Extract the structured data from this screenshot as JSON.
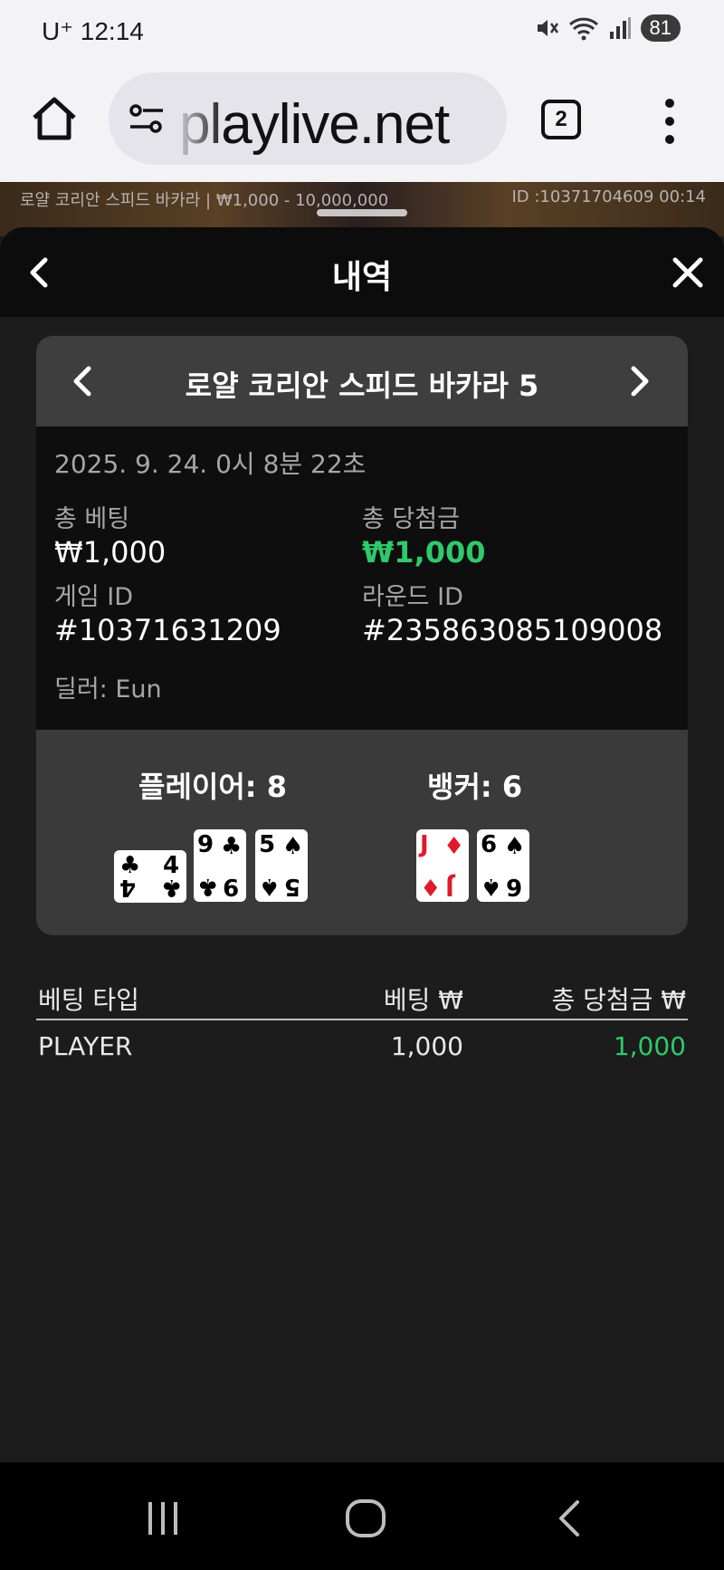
{
  "status": {
    "carrier": "U⁺ 12:14",
    "battery": "81",
    "icons": [
      "mute-icon",
      "wifi-icon",
      "signal-icon"
    ]
  },
  "browser": {
    "url": "playlive.net",
    "tab_count": "2"
  },
  "game_strip": {
    "left_text": "로얄 코리안 스피드 바카라 | ₩1,000 - 10,000,000",
    "right_text": "ID :10371704609 00:14"
  },
  "panel": {
    "title": "내역"
  },
  "round": {
    "game_name": "로얄 코리안 스피드 바카라 5",
    "date": "2025. 9. 24. 0시 8분 22초",
    "total_bet_label": "총 베팅",
    "total_bet_value": "₩1,000",
    "total_win_label": "총 당첨금",
    "total_win_value": "₩1,000",
    "game_id_label": "게임 ID",
    "game_id_value": "#10371631209",
    "round_id_label": "라운드 ID",
    "round_id_value": "#235863085109008",
    "dealer": "딜러: Eun"
  },
  "hands": {
    "player_score": "플레이어: 8",
    "banker_score": "뱅커: 6",
    "player_cards": [
      {
        "rank": "4",
        "suit": "♣",
        "color": "#000000",
        "orientation": "sideways"
      },
      {
        "rank": "9",
        "suit": "♣",
        "color": "#000000"
      },
      {
        "rank": "5",
        "suit": "♠",
        "color": "#000000"
      }
    ],
    "banker_cards": [
      {
        "rank": "J",
        "suit": "♦",
        "color": "#e0192d"
      },
      {
        "rank": "6",
        "suit": "♠",
        "color": "#000000"
      }
    ]
  },
  "bets": {
    "headers": [
      "베팅 타입",
      "베팅 ₩",
      "총 당첨금 ₩"
    ],
    "rows": [
      {
        "type": "PLAYER",
        "bet": "1,000",
        "win": "1,000"
      }
    ]
  },
  "colors": {
    "win_green": "#2ec96b",
    "panel_bg": "#1c1c1c",
    "card_head": "#3e3e3e"
  }
}
